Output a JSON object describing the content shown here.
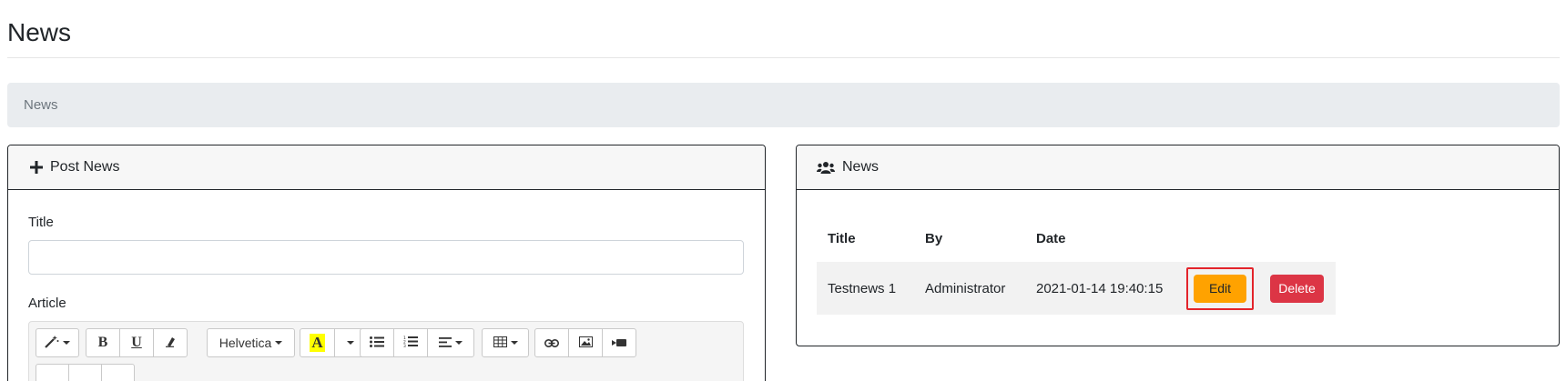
{
  "page": {
    "title": "News"
  },
  "breadcrumb": {
    "current": "News"
  },
  "post_card": {
    "header": "Post News",
    "title_label": "Title",
    "title_value": "",
    "article_label": "Article",
    "toolbar": {
      "font_name": "Helvetica",
      "bold": "B",
      "underline": "U",
      "highlight": "A"
    }
  },
  "news_card": {
    "header": "News",
    "columns": [
      "Title",
      "By",
      "Date"
    ],
    "rows": [
      {
        "title": "Testnews 1",
        "by": "Administrator",
        "date": "2021-01-14 19:40:15",
        "edit_label": "Edit",
        "delete_label": "Delete"
      }
    ]
  },
  "colors": {
    "edit": "#ffa200",
    "delete": "#dc3545",
    "highlight": "#ffff00",
    "focus_outline": "#e3242b"
  }
}
